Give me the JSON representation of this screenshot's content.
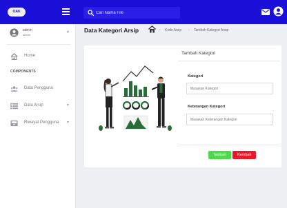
{
  "brand": {
    "logo_text": "OAK",
    "colors": {
      "primary": "#1a0fd6",
      "success": "#4dd94a",
      "danger": "#e8192c"
    }
  },
  "topbar": {
    "menu_icon": "hamburger-icon",
    "search": {
      "placeholder": "Cari Nama File",
      "icon": "search-icon"
    },
    "mail_icon": "mail-icon",
    "user_icon": "user-circle-icon"
  },
  "sidebar": {
    "profile": {
      "name": "admin",
      "role": "admin"
    },
    "home": {
      "label": "Home",
      "icon": "home-icon"
    },
    "section_label": "COMPONENTS",
    "items": [
      {
        "label": "Data Pengguna",
        "icon": "users-icon",
        "has_caret": false
      },
      {
        "label": "Data Arsip",
        "icon": "list-icon",
        "has_caret": true
      },
      {
        "label": "Riwayat Pengguna",
        "icon": "inbox-icon",
        "has_caret": true
      }
    ]
  },
  "header": {
    "title": "Data Kategori Arsip",
    "breadcrumb": [
      "Kode Arsip",
      "Tambah Kategori Arsip"
    ]
  },
  "form": {
    "title": "Tambah Kategori",
    "fields": [
      {
        "label": "Kategori",
        "placeholder": "Masukan Kategori",
        "value": ""
      },
      {
        "label": "Keterangan Kategori",
        "placeholder": "Masukan Keterangan Kategori",
        "value": ""
      }
    ],
    "save_label": "Tambah",
    "back_label": "Kembali"
  }
}
